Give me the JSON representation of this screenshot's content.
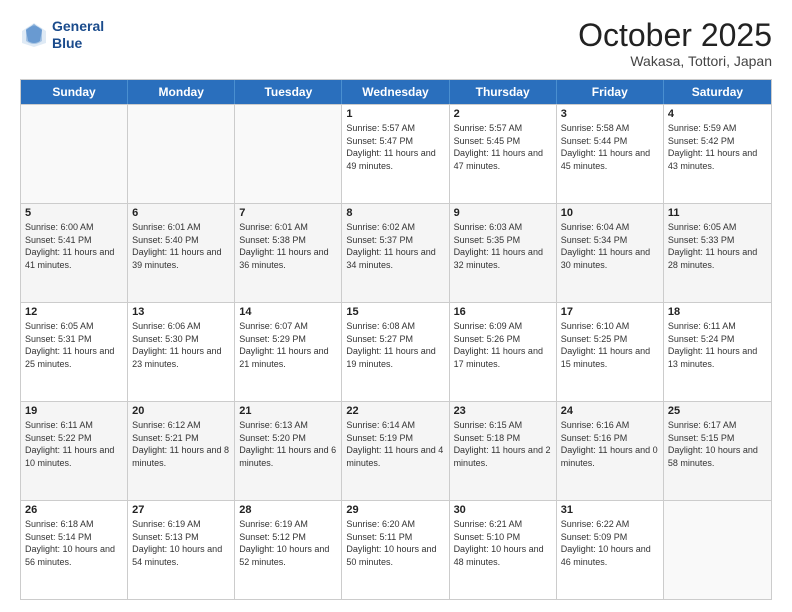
{
  "header": {
    "logo_line1": "General",
    "logo_line2": "Blue",
    "month": "October 2025",
    "location": "Wakasa, Tottori, Japan"
  },
  "weekdays": [
    "Sunday",
    "Monday",
    "Tuesday",
    "Wednesday",
    "Thursday",
    "Friday",
    "Saturday"
  ],
  "rows": [
    [
      {
        "day": "",
        "sunrise": "",
        "sunset": "",
        "daylight": "",
        "empty": true
      },
      {
        "day": "",
        "sunrise": "",
        "sunset": "",
        "daylight": "",
        "empty": true
      },
      {
        "day": "",
        "sunrise": "",
        "sunset": "",
        "daylight": "",
        "empty": true
      },
      {
        "day": "1",
        "sunrise": "Sunrise: 5:57 AM",
        "sunset": "Sunset: 5:47 PM",
        "daylight": "Daylight: 11 hours and 49 minutes."
      },
      {
        "day": "2",
        "sunrise": "Sunrise: 5:57 AM",
        "sunset": "Sunset: 5:45 PM",
        "daylight": "Daylight: 11 hours and 47 minutes."
      },
      {
        "day": "3",
        "sunrise": "Sunrise: 5:58 AM",
        "sunset": "Sunset: 5:44 PM",
        "daylight": "Daylight: 11 hours and 45 minutes."
      },
      {
        "day": "4",
        "sunrise": "Sunrise: 5:59 AM",
        "sunset": "Sunset: 5:42 PM",
        "daylight": "Daylight: 11 hours and 43 minutes."
      }
    ],
    [
      {
        "day": "5",
        "sunrise": "Sunrise: 6:00 AM",
        "sunset": "Sunset: 5:41 PM",
        "daylight": "Daylight: 11 hours and 41 minutes."
      },
      {
        "day": "6",
        "sunrise": "Sunrise: 6:01 AM",
        "sunset": "Sunset: 5:40 PM",
        "daylight": "Daylight: 11 hours and 39 minutes."
      },
      {
        "day": "7",
        "sunrise": "Sunrise: 6:01 AM",
        "sunset": "Sunset: 5:38 PM",
        "daylight": "Daylight: 11 hours and 36 minutes."
      },
      {
        "day": "8",
        "sunrise": "Sunrise: 6:02 AM",
        "sunset": "Sunset: 5:37 PM",
        "daylight": "Daylight: 11 hours and 34 minutes."
      },
      {
        "day": "9",
        "sunrise": "Sunrise: 6:03 AM",
        "sunset": "Sunset: 5:35 PM",
        "daylight": "Daylight: 11 hours and 32 minutes."
      },
      {
        "day": "10",
        "sunrise": "Sunrise: 6:04 AM",
        "sunset": "Sunset: 5:34 PM",
        "daylight": "Daylight: 11 hours and 30 minutes."
      },
      {
        "day": "11",
        "sunrise": "Sunrise: 6:05 AM",
        "sunset": "Sunset: 5:33 PM",
        "daylight": "Daylight: 11 hours and 28 minutes."
      }
    ],
    [
      {
        "day": "12",
        "sunrise": "Sunrise: 6:05 AM",
        "sunset": "Sunset: 5:31 PM",
        "daylight": "Daylight: 11 hours and 25 minutes."
      },
      {
        "day": "13",
        "sunrise": "Sunrise: 6:06 AM",
        "sunset": "Sunset: 5:30 PM",
        "daylight": "Daylight: 11 hours and 23 minutes."
      },
      {
        "day": "14",
        "sunrise": "Sunrise: 6:07 AM",
        "sunset": "Sunset: 5:29 PM",
        "daylight": "Daylight: 11 hours and 21 minutes."
      },
      {
        "day": "15",
        "sunrise": "Sunrise: 6:08 AM",
        "sunset": "Sunset: 5:27 PM",
        "daylight": "Daylight: 11 hours and 19 minutes."
      },
      {
        "day": "16",
        "sunrise": "Sunrise: 6:09 AM",
        "sunset": "Sunset: 5:26 PM",
        "daylight": "Daylight: 11 hours and 17 minutes."
      },
      {
        "day": "17",
        "sunrise": "Sunrise: 6:10 AM",
        "sunset": "Sunset: 5:25 PM",
        "daylight": "Daylight: 11 hours and 15 minutes."
      },
      {
        "day": "18",
        "sunrise": "Sunrise: 6:11 AM",
        "sunset": "Sunset: 5:24 PM",
        "daylight": "Daylight: 11 hours and 13 minutes."
      }
    ],
    [
      {
        "day": "19",
        "sunrise": "Sunrise: 6:11 AM",
        "sunset": "Sunset: 5:22 PM",
        "daylight": "Daylight: 11 hours and 10 minutes."
      },
      {
        "day": "20",
        "sunrise": "Sunrise: 6:12 AM",
        "sunset": "Sunset: 5:21 PM",
        "daylight": "Daylight: 11 hours and 8 minutes."
      },
      {
        "day": "21",
        "sunrise": "Sunrise: 6:13 AM",
        "sunset": "Sunset: 5:20 PM",
        "daylight": "Daylight: 11 hours and 6 minutes."
      },
      {
        "day": "22",
        "sunrise": "Sunrise: 6:14 AM",
        "sunset": "Sunset: 5:19 PM",
        "daylight": "Daylight: 11 hours and 4 minutes."
      },
      {
        "day": "23",
        "sunrise": "Sunrise: 6:15 AM",
        "sunset": "Sunset: 5:18 PM",
        "daylight": "Daylight: 11 hours and 2 minutes."
      },
      {
        "day": "24",
        "sunrise": "Sunrise: 6:16 AM",
        "sunset": "Sunset: 5:16 PM",
        "daylight": "Daylight: 11 hours and 0 minutes."
      },
      {
        "day": "25",
        "sunrise": "Sunrise: 6:17 AM",
        "sunset": "Sunset: 5:15 PM",
        "daylight": "Daylight: 10 hours and 58 minutes."
      }
    ],
    [
      {
        "day": "26",
        "sunrise": "Sunrise: 6:18 AM",
        "sunset": "Sunset: 5:14 PM",
        "daylight": "Daylight: 10 hours and 56 minutes."
      },
      {
        "day": "27",
        "sunrise": "Sunrise: 6:19 AM",
        "sunset": "Sunset: 5:13 PM",
        "daylight": "Daylight: 10 hours and 54 minutes."
      },
      {
        "day": "28",
        "sunrise": "Sunrise: 6:19 AM",
        "sunset": "Sunset: 5:12 PM",
        "daylight": "Daylight: 10 hours and 52 minutes."
      },
      {
        "day": "29",
        "sunrise": "Sunrise: 6:20 AM",
        "sunset": "Sunset: 5:11 PM",
        "daylight": "Daylight: 10 hours and 50 minutes."
      },
      {
        "day": "30",
        "sunrise": "Sunrise: 6:21 AM",
        "sunset": "Sunset: 5:10 PM",
        "daylight": "Daylight: 10 hours and 48 minutes."
      },
      {
        "day": "31",
        "sunrise": "Sunrise: 6:22 AM",
        "sunset": "Sunset: 5:09 PM",
        "daylight": "Daylight: 10 hours and 46 minutes."
      },
      {
        "day": "",
        "sunrise": "",
        "sunset": "",
        "daylight": "",
        "empty": true
      }
    ]
  ]
}
